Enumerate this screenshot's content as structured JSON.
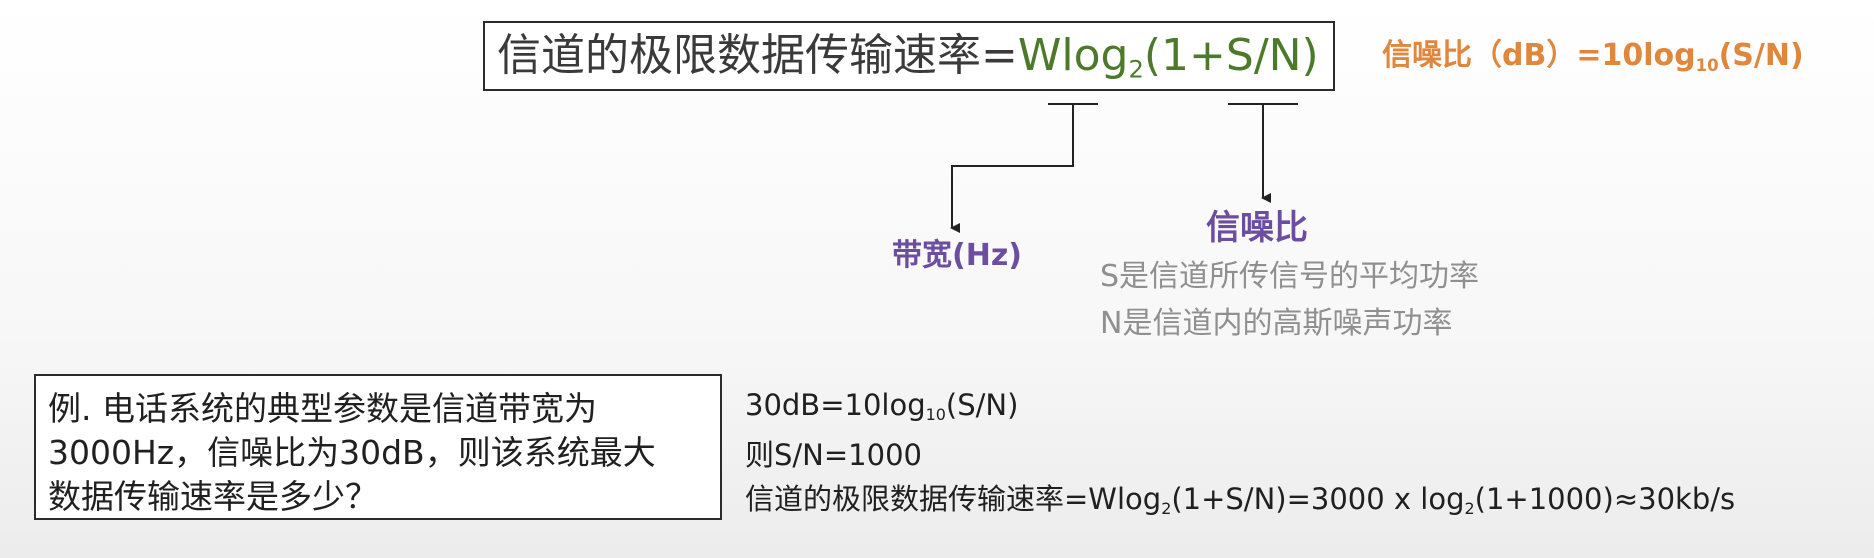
{
  "formula": {
    "prefix": "信道的极限数据传输速率=",
    "w": "Wlog",
    "base": "2",
    "tail": "(1+S/N)"
  },
  "snr_db": {
    "prefix": "信噪比（dB）=10log",
    "base": "10",
    "tail": "(S/N)"
  },
  "labels": {
    "bandwidth": "带宽(Hz)",
    "snr": "信噪比",
    "s_desc": "S是信道所传信号的平均功率",
    "n_desc": "N是信道内的高斯噪声功率"
  },
  "example": {
    "line1": "例. 电话系统的典型参数是信道带宽为",
    "line2": "3000Hz，信噪比为30dB，则该系统最大",
    "line3": "数据传输速率是多少？"
  },
  "solution": {
    "l1_prefix": "30dB=10log",
    "l1_base": "10",
    "l1_tail": "(S/N)",
    "line2": "则S/N=1000",
    "l3_prefix": "信道的极限数据传输速率=Wlog",
    "l3_base1": "2",
    "l3_mid": "(1+S/N)=3000 x log",
    "l3_base2": "2",
    "l3_tail": "(1+1000)≈30kb/s"
  },
  "colors": {
    "formula_green": "#4d7a2a",
    "snr_orange": "#e0873e",
    "label_purple": "#6b4ea0",
    "desc_gray": "#8f8f8f"
  }
}
